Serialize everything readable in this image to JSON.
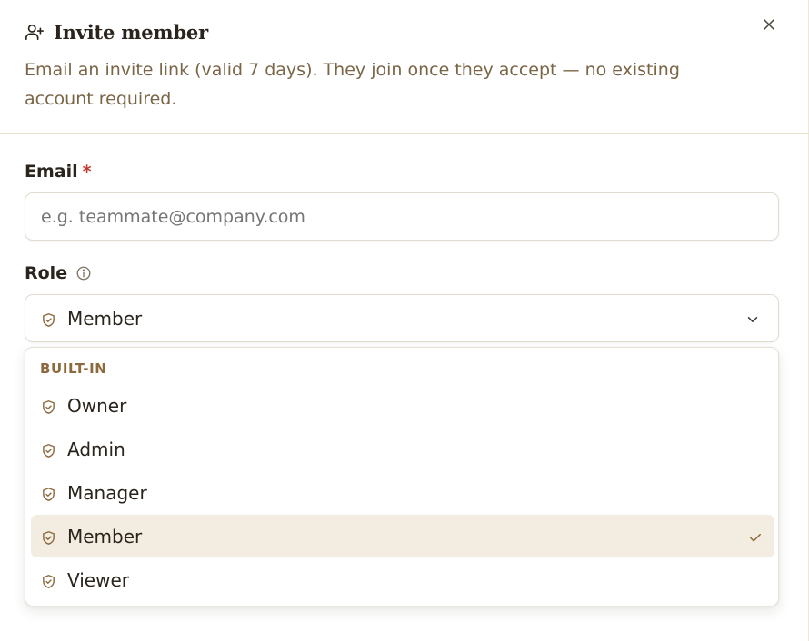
{
  "dialog": {
    "title": "Invite member",
    "title_icon": "user-plus-icon",
    "close_icon": "close-icon",
    "description": "Email an invite link (valid 7 days). They join once they accept — no existing account required."
  },
  "email": {
    "label": "Email",
    "required_marker": "*",
    "placeholder": "e.g. teammate@company.com",
    "value": ""
  },
  "role": {
    "label": "Role",
    "info_icon": "info-icon",
    "selected": "Member",
    "dropdown_icon": "chevron-down-icon",
    "menu": {
      "group_label": "BUILT-IN",
      "options": [
        {
          "label": "Owner",
          "icon": "shield-check-icon",
          "selected": false
        },
        {
          "label": "Admin",
          "icon": "shield-check-icon",
          "selected": false
        },
        {
          "label": "Manager",
          "icon": "shield-check-icon",
          "selected": false
        },
        {
          "label": "Member",
          "icon": "shield-check-icon",
          "selected": true
        },
        {
          "label": "Viewer",
          "icon": "shield-check-icon",
          "selected": false
        }
      ]
    }
  },
  "colors": {
    "accent": "#8c6a3d",
    "description_text": "#7a6546",
    "selected_bg": "#f3ece0",
    "required": "#c0392b"
  }
}
